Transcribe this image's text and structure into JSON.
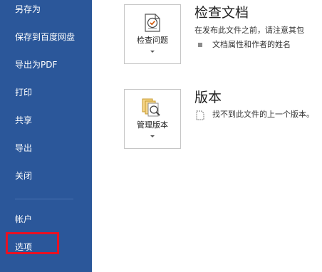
{
  "sidebar": {
    "items": [
      {
        "label": "另存为"
      },
      {
        "label": "保存到百度网盘"
      },
      {
        "label": "导出为PDF"
      },
      {
        "label": "打印"
      },
      {
        "label": "共享"
      },
      {
        "label": "导出"
      },
      {
        "label": "关闭"
      },
      {
        "label": "帐户"
      },
      {
        "label": "选项"
      }
    ]
  },
  "inspect": {
    "button_label": "检查问题",
    "title": "检查文档",
    "description": "在发布此文件之前，请注意其包",
    "bullet": "文档属性和作者的姓名"
  },
  "versions": {
    "button_label": "管理版本",
    "title": "版本",
    "description": "找不到此文件的上一个版本。"
  },
  "colors": {
    "sidebar_bg": "#2b579a",
    "highlight": "#e81123"
  }
}
